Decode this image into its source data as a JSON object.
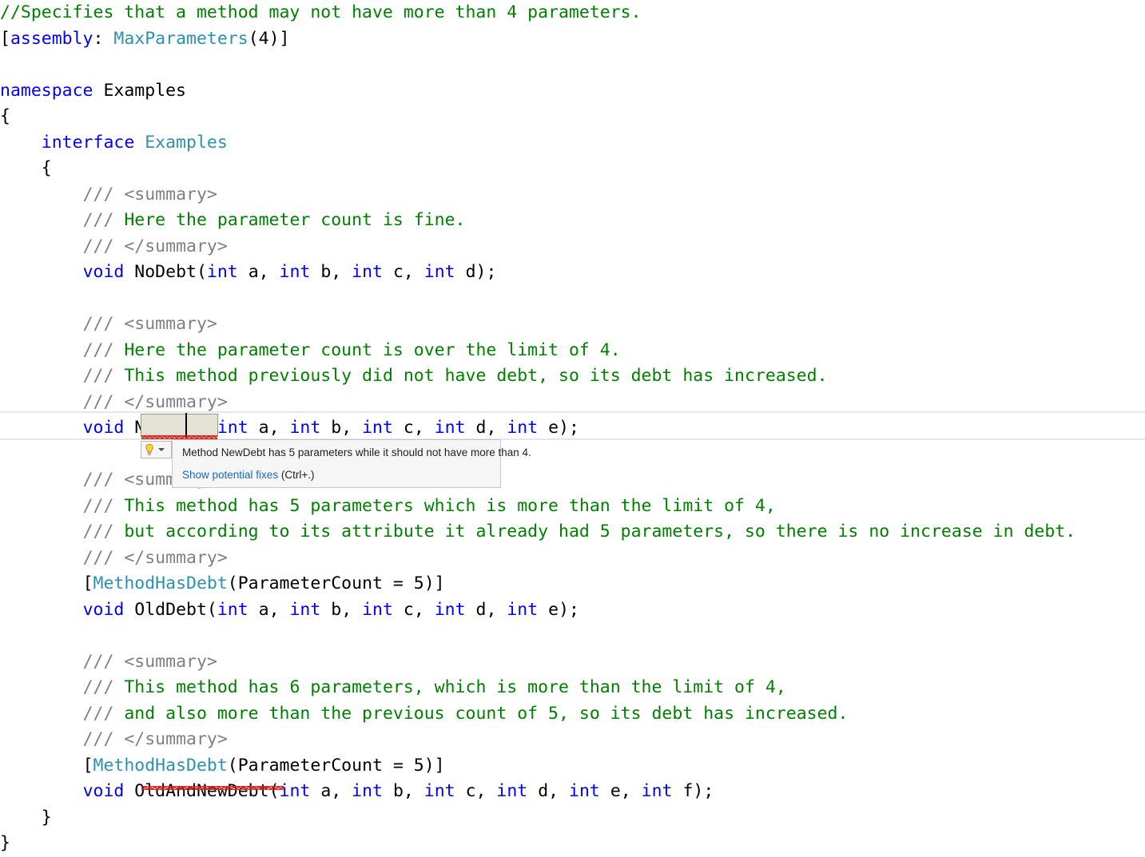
{
  "editor": {
    "language": "csharp",
    "background_color": "#ffffff",
    "colors": {
      "comment": "#008000",
      "doc_comment_tag": "#808080",
      "doc_comment_text": "#008000",
      "keyword": "#0000ff",
      "type": "#2b91af",
      "plain": "#000000",
      "error_squiggle": "#e01b1b",
      "current_line_border": "#e6e6f2",
      "selection_highlight": "#e4e4d4",
      "link": "#1569c7"
    },
    "lines": [
      {
        "n": 1,
        "text": "//Specifies that a method may not have more than 4 parameters."
      },
      {
        "n": 2,
        "text": "[assembly: MaxParameters(4)]"
      },
      {
        "n": 3,
        "text": ""
      },
      {
        "n": 4,
        "text": "namespace Examples"
      },
      {
        "n": 5,
        "text": "{"
      },
      {
        "n": 6,
        "text": "    interface Examples"
      },
      {
        "n": 7,
        "text": "    {"
      },
      {
        "n": 8,
        "text": "        /// <summary>"
      },
      {
        "n": 9,
        "text": "        /// Here the parameter count is fine."
      },
      {
        "n": 10,
        "text": "        /// </summary>"
      },
      {
        "n": 11,
        "text": "        void NoDebt(int a, int b, int c, int d);"
      },
      {
        "n": 12,
        "text": ""
      },
      {
        "n": 13,
        "text": "        /// <summary>"
      },
      {
        "n": 14,
        "text": "        /// Here the parameter count is over the limit of 4."
      },
      {
        "n": 15,
        "text": "        /// This method previously did not have debt, so its debt has increased."
      },
      {
        "n": 16,
        "text": "        /// </summary>"
      },
      {
        "n": 17,
        "text": "        void NewDebt(int a, int b, int c, int d, int e);"
      },
      {
        "n": 18,
        "text": ""
      },
      {
        "n": 19,
        "text": "        /// <summary>"
      },
      {
        "n": 20,
        "text": "        /// This method has 5 parameters which is more than the limit of 4,"
      },
      {
        "n": 21,
        "text": "        /// but according to its attribute it already had 5 parameters, so there is no increase in debt."
      },
      {
        "n": 22,
        "text": "        /// </summary>"
      },
      {
        "n": 23,
        "text": "        [MethodHasDebt(ParameterCount = 5)]"
      },
      {
        "n": 24,
        "text": "        void OldDebt(int a, int b, int c, int d, int e);"
      },
      {
        "n": 25,
        "text": ""
      },
      {
        "n": 26,
        "text": "        /// <summary>"
      },
      {
        "n": 27,
        "text": "        /// This method has 6 parameters, which is more than the limit of 4,"
      },
      {
        "n": 28,
        "text": "        /// and also more than the previous count of 5, so its debt has increased."
      },
      {
        "n": 29,
        "text": "        /// </summary>"
      },
      {
        "n": 30,
        "text": "        [MethodHasDebt(ParameterCount = 5)]"
      },
      {
        "n": 31,
        "text": "        void OldAndNewDebt(int a, int b, int c, int d, int e, int f);"
      },
      {
        "n": 32,
        "text": "    }"
      },
      {
        "n": 33,
        "text": "}"
      }
    ],
    "tokens": {
      "l1_comment": "//Specifies that a method may not have more than 4 parameters.",
      "l2_bracket_open": "[",
      "l2_assembly": "assembly",
      "l2_colon": ": ",
      "l2_attr": "MaxParameters",
      "l2_args": "(4)]",
      "l4_namespace": "namespace",
      "l4_name": " Examples",
      "l5_brace": "{",
      "l6_interface": "interface",
      "l6_name": " Examples",
      "l7_brace": "{",
      "doc_slashes": "/// ",
      "tag_summary_open": "<summary>",
      "tag_summary_close": "</summary>",
      "l9_text": "Here the parameter count is fine.",
      "l11_void": "void",
      "l11_name": " NoDebt(",
      "l11_int": "int",
      "l14_text": "Here the parameter count is over the limit of 4.",
      "l15_text": "This method previously did not have debt, so its debt has increased.",
      "l17_void": "void",
      "l17_name": "NewDebt",
      "l20_text": "This method has 5 parameters which is more than the limit of 4,",
      "l21_text": "but according to its attribute it already had 5 parameters, so there is no increase in debt.",
      "attr_open": "[",
      "attr_type": "MethodHasDebt",
      "attr_args": "(ParameterCount = 5)]",
      "l24_name": " OldDebt(",
      "l27_text": "This method has 6 parameters, which is more than the limit of 4,",
      "l28_text": "and also more than the previous count of 5, so its debt has increased.",
      "l31_name": "OldAndNewDebt",
      "l32_brace": "}",
      "l33_brace": "}"
    }
  },
  "quickfix": {
    "lightbulb_icon": "lightbulb-icon",
    "dropdown_icon": "chevron-down-icon",
    "message": "Method NewDebt has 5 parameters while it should not have more than 4.",
    "action_label": "Show potential fixes",
    "action_shortcut": "(Ctrl+.)"
  }
}
